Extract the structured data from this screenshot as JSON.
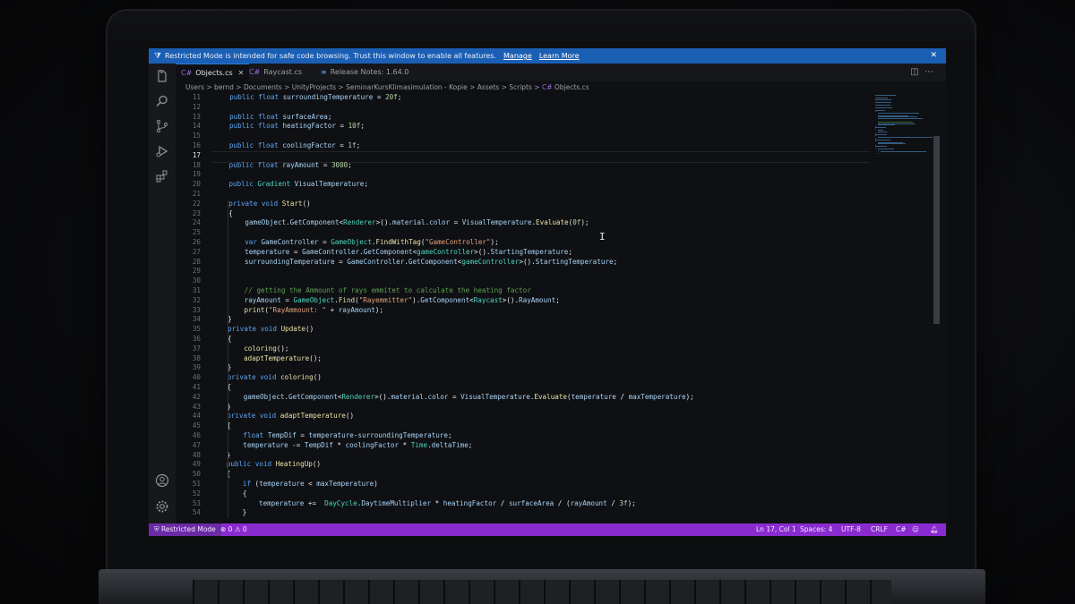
{
  "banner": {
    "message": "Restricted Mode is intended for safe code browsing. Trust this window to enable all features.",
    "manage_label": "Manage",
    "learn_more_label": "Learn More",
    "close_glyph": "✕"
  },
  "tabs": [
    {
      "label": "Objects.cs",
      "icon": "C#",
      "active": true,
      "close": "✕"
    },
    {
      "label": "Raycast.cs",
      "icon": "C#",
      "active": false
    },
    {
      "label": "Release Notes: 1.64.0",
      "icon": "≡",
      "active": false
    }
  ],
  "breadcrumb": "Users > bernd > Documents > UnityProjects > SeminarKursKlimasimulation - Kopie > Assets > Scripts > ",
  "breadcrumb_file": "Objects.cs",
  "activity_icons": [
    "files-icon",
    "search-icon",
    "source-control-icon",
    "run-debug-icon",
    "extensions-icon",
    "account-icon",
    "settings-gear-icon"
  ],
  "code": {
    "current_line": 17,
    "lines": [
      {
        "n": 11,
        "indent": 1,
        "t": "public float surroundingTemperature = 20f;"
      },
      {
        "n": 12,
        "indent": 0,
        "t": ""
      },
      {
        "n": 13,
        "indent": 1,
        "t": "public float surfaceArea;"
      },
      {
        "n": 14,
        "indent": 1,
        "t": "public float heatingFactor = 10f;"
      },
      {
        "n": 15,
        "indent": 0,
        "t": ""
      },
      {
        "n": 16,
        "indent": 1,
        "t": "public float coolingFactor = 1f;"
      },
      {
        "n": 17,
        "indent": 0,
        "t": ""
      },
      {
        "n": 18,
        "indent": 1,
        "t": "public float rayAmount = 3000;"
      },
      {
        "n": 19,
        "indent": 0,
        "t": ""
      },
      {
        "n": 20,
        "indent": 1,
        "t": "public Gradient VisualTemperature;"
      },
      {
        "n": 21,
        "indent": 0,
        "t": ""
      },
      {
        "n": 22,
        "indent": 1,
        "t": "private void Start()"
      },
      {
        "n": 23,
        "indent": 1,
        "t": "{"
      },
      {
        "n": 24,
        "indent": 2,
        "t": "gameObject.GetComponent<Renderer>().material.color = VisualTemperature.Evaluate(0f);"
      },
      {
        "n": 25,
        "indent": 0,
        "t": ""
      },
      {
        "n": 26,
        "indent": 2,
        "t": "var GameController = GameObject.FindWithTag(\"GameController\");"
      },
      {
        "n": 27,
        "indent": 2,
        "t": "temperature = GameController.GetComponent<gameController>().StartingTemperature;"
      },
      {
        "n": 28,
        "indent": 2,
        "t": "surroundingTemperature = GameController.GetComponent<gameController>().StartingTemperature;"
      },
      {
        "n": 29,
        "indent": 0,
        "t": ""
      },
      {
        "n": 30,
        "indent": 0,
        "t": ""
      },
      {
        "n": 31,
        "indent": 2,
        "t": "// getting the Ammount of rays emmitet to calculate the heating factor"
      },
      {
        "n": 32,
        "indent": 2,
        "t": "rayAmount = GameObject.Find(\"Rayemmitter\").GetComponent<Raycast>().RayAmount;"
      },
      {
        "n": 33,
        "indent": 2,
        "t": "print(\"RayAmmount: \" + rayAmount);"
      },
      {
        "n": 34,
        "indent": 1,
        "t": "}"
      },
      {
        "n": 35,
        "indent": 1,
        "t": "private void Update()"
      },
      {
        "n": 36,
        "indent": 1,
        "t": "{"
      },
      {
        "n": 37,
        "indent": 2,
        "t": "coloring();"
      },
      {
        "n": 38,
        "indent": 2,
        "t": "adaptTemperature();"
      },
      {
        "n": 39,
        "indent": 1,
        "t": "}"
      },
      {
        "n": 40,
        "indent": 1,
        "t": "private void coloring()"
      },
      {
        "n": 41,
        "indent": 1,
        "t": "{"
      },
      {
        "n": 42,
        "indent": 2,
        "t": "gameObject.GetComponent<Renderer>().material.color = VisualTemperature.Evaluate(temperature / maxTemperature);"
      },
      {
        "n": 43,
        "indent": 1,
        "t": "}"
      },
      {
        "n": 44,
        "indent": 1,
        "t": "private void adaptTemperature()"
      },
      {
        "n": 45,
        "indent": 1,
        "t": "{"
      },
      {
        "n": 46,
        "indent": 2,
        "t": "float TempDif = temperature-surroundingTemperature;"
      },
      {
        "n": 47,
        "indent": 2,
        "t": "temperature -= TempDif * coolingFactor * Time.deltaTime;"
      },
      {
        "n": 48,
        "indent": 1,
        "t": "}"
      },
      {
        "n": 49,
        "indent": 1,
        "t": "public void HeatingUp()"
      },
      {
        "n": 50,
        "indent": 1,
        "t": "{"
      },
      {
        "n": 51,
        "indent": 2,
        "t": "if (temperature < maxTemperature)"
      },
      {
        "n": 52,
        "indent": 2,
        "t": "{"
      },
      {
        "n": 53,
        "indent": 3,
        "t": "temperature +=  DayCycle.DaytimeMultiplier * heatingFactor / surfaceArea / (rayAmount / 3f);"
      },
      {
        "n": 54,
        "indent": 2,
        "t": "}"
      }
    ]
  },
  "status": {
    "restricted_mode": "Restricted Mode",
    "problems": "⊗ 0 ⚠ 0",
    "position": "Ln 17, Col 1",
    "spaces": "Spaces: 4",
    "encoding": "UTF-8",
    "eol": "CRLF",
    "language": "C#"
  },
  "colors": {
    "banner": "#1b5fb4",
    "status_bar": "#8a2bd0",
    "editor_bg": "#0f1013",
    "keyword": "#5da5f5",
    "type": "#4fd3bf",
    "function": "#e9e3a6",
    "string": "#e2a27a",
    "comment": "#5f9f54"
  }
}
